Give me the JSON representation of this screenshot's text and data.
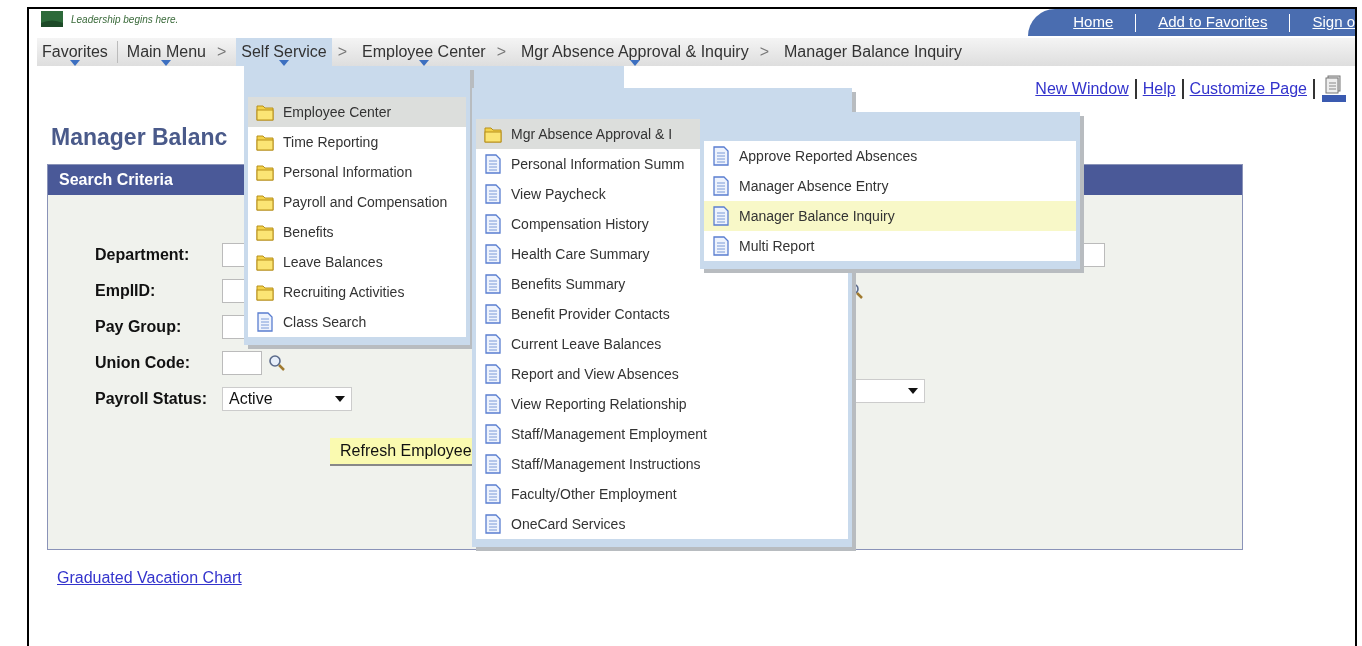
{
  "header": {
    "tagline": "Leadership begins here.",
    "links": [
      "Home",
      "Add to Favorites",
      "Sign o"
    ]
  },
  "breadcrumbs": [
    {
      "label": "Favorites",
      "selected": false
    },
    {
      "label": "Main Menu",
      "selected": false,
      "separator": ">"
    },
    {
      "label": "Self Service",
      "selected": true,
      "separator": ">"
    },
    {
      "label": "Employee Center",
      "selected": false,
      "separator": ">"
    },
    {
      "label": "Mgr Absence Approval & Inquiry",
      "selected": false,
      "separator": ">"
    },
    {
      "label": "Manager Balance Inquiry",
      "selected": false
    }
  ],
  "page_links": [
    "New Window",
    "Help",
    "Customize Page"
  ],
  "page_title": "Manager Balanc",
  "search": {
    "title": "Search Criteria",
    "fields": [
      {
        "label": "Department:",
        "kind": "text"
      },
      {
        "label": "EmplID:",
        "kind": "text"
      },
      {
        "label": "Pay Group:",
        "kind": "text"
      },
      {
        "label": "Union Code:",
        "kind": "lookup"
      },
      {
        "label": "Payroll Status:",
        "kind": "select",
        "value": "Active"
      }
    ],
    "right_fields": [
      {
        "kind": "text"
      },
      {
        "kind": "lookup"
      },
      {
        "kind": "select"
      }
    ],
    "button": "Refresh Employee"
  },
  "footer_link": "Graduated Vacation Chart",
  "menus": [
    {
      "items": [
        {
          "label": "Employee Center",
          "kind": "folder",
          "selected": true
        },
        {
          "label": "Time Reporting",
          "kind": "folder",
          "selected": false
        },
        {
          "label": "Personal Information",
          "kind": "folder",
          "selected": false
        },
        {
          "label": "Payroll and Compensation",
          "kind": "folder",
          "selected": false
        },
        {
          "label": "Benefits",
          "kind": "folder",
          "selected": false
        },
        {
          "label": "Leave Balances",
          "kind": "folder",
          "selected": false
        },
        {
          "label": "Recruiting Activities",
          "kind": "folder",
          "selected": false
        },
        {
          "label": "Class Search",
          "kind": "page",
          "selected": false
        }
      ]
    },
    {
      "items": [
        {
          "label": "Mgr Absence Approval & I",
          "kind": "folder",
          "selected": true
        },
        {
          "label": "Personal Information Summ",
          "kind": "page",
          "selected": false
        },
        {
          "label": "View Paycheck",
          "kind": "page",
          "selected": false
        },
        {
          "label": "Compensation History",
          "kind": "page",
          "selected": false
        },
        {
          "label": "Health Care Summary",
          "kind": "page",
          "selected": false
        },
        {
          "label": "Benefits Summary",
          "kind": "page",
          "selected": false
        },
        {
          "label": "Benefit Provider Contacts",
          "kind": "page",
          "selected": false
        },
        {
          "label": "Current Leave Balances",
          "kind": "page",
          "selected": false
        },
        {
          "label": "Report and View Absences",
          "kind": "page",
          "selected": false
        },
        {
          "label": "View Reporting Relationship",
          "kind": "page",
          "selected": false
        },
        {
          "label": "Staff/Management Employment",
          "kind": "page",
          "selected": false
        },
        {
          "label": "Staff/Management Instructions",
          "kind": "page",
          "selected": false
        },
        {
          "label": "Faculty/Other Employment",
          "kind": "page",
          "selected": false
        },
        {
          "label": "OneCard Services",
          "kind": "page",
          "selected": false
        }
      ]
    },
    {
      "items": [
        {
          "label": "Approve Reported Absences",
          "kind": "page",
          "selected": false
        },
        {
          "label": "Manager Absence Entry",
          "kind": "page",
          "selected": false
        },
        {
          "label": "Manager Balance Inquiry",
          "kind": "page",
          "selected": true
        },
        {
          "label": "Multi Report",
          "kind": "page",
          "selected": false
        }
      ]
    }
  ]
}
